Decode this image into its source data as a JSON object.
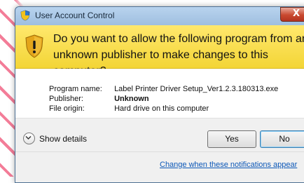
{
  "window": {
    "title": "User Account Control",
    "close_label": "X"
  },
  "header": {
    "message_line1": "Do you want to allow the following program from an",
    "message_line2": "unknown publisher to make changes to this computer?"
  },
  "details": {
    "rows": [
      {
        "label": "Program name:",
        "value": "Label Printer Driver Setup_Ver1.2.3.180313.exe",
        "bold": false
      },
      {
        "label": "Publisher:",
        "value": "Unknown",
        "bold": true
      },
      {
        "label": "File origin:",
        "value": "Hard drive on this computer",
        "bold": false
      }
    ]
  },
  "actions": {
    "show_details_label": "Show details",
    "yes_label": "Yes",
    "no_label": "No"
  },
  "footer": {
    "link_text": "Change when these notifications appear"
  },
  "colors": {
    "header_bg": "#f3d536",
    "link": "#0b57b7",
    "titlebar": "#9fbfe0",
    "close_btn": "#c9492f"
  }
}
